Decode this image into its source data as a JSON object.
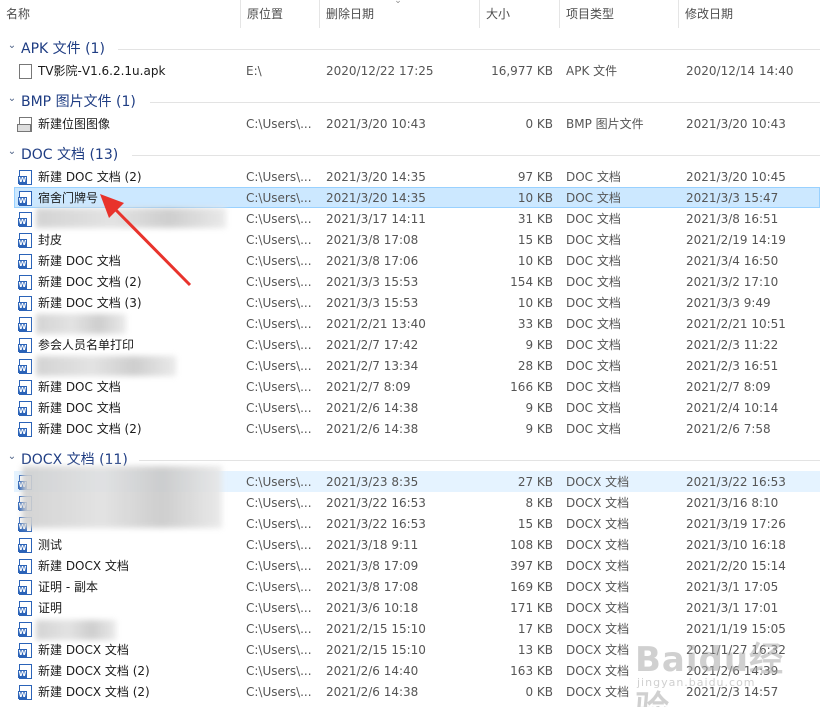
{
  "columns": {
    "name": "名称",
    "location": "原位置",
    "deleted": "删除日期",
    "size": "大小",
    "type": "项目类型",
    "modified": "修改日期"
  },
  "groups": [
    {
      "title": "APK 文件 (1)",
      "rows": [
        {
          "name": "TV影院-V1.6.2.1u.apk",
          "location": "E:\\",
          "deleted": "2020/12/22 17:25",
          "size": "16,977 KB",
          "type": "APK 文件",
          "modified": "2020/12/14 14:40",
          "icon": "apk-file-icon"
        }
      ]
    },
    {
      "title": "BMP 图片文件 (1)",
      "rows": [
        {
          "name": "新建位图图像",
          "location": "C:\\Users\\...",
          "deleted": "2021/3/20 10:43",
          "size": "0 KB",
          "type": "BMP 图片文件",
          "modified": "2021/3/20 10:43",
          "icon": "bmp-file-icon"
        }
      ]
    },
    {
      "title": "DOC 文档 (13)",
      "rows": [
        {
          "name": "新建 DOC 文档 (2)",
          "location": "C:\\Users\\...",
          "deleted": "2021/3/20 14:35",
          "size": "97 KB",
          "type": "DOC 文档",
          "modified": "2021/3/20 10:45"
        },
        {
          "name": "宿舍门牌号",
          "location": "C:\\Users\\...",
          "deleted": "2021/3/20 14:35",
          "size": "10 KB",
          "type": "DOC 文档",
          "modified": "2021/3/3 15:47"
        },
        {
          "name": "",
          "location": "C:\\Users\\...",
          "deleted": "2021/3/17 14:11",
          "size": "31 KB",
          "type": "DOC 文档",
          "modified": "2021/3/8 16:51"
        },
        {
          "name": "封皮",
          "location": "C:\\Users\\...",
          "deleted": "2021/3/8 17:08",
          "size": "15 KB",
          "type": "DOC 文档",
          "modified": "2021/2/19 14:19"
        },
        {
          "name": "新建 DOC 文档",
          "location": "C:\\Users\\...",
          "deleted": "2021/3/8 17:06",
          "size": "10 KB",
          "type": "DOC 文档",
          "modified": "2021/3/4 16:50"
        },
        {
          "name": "新建 DOC 文档 (2)",
          "location": "C:\\Users\\...",
          "deleted": "2021/3/3 15:53",
          "size": "154 KB",
          "type": "DOC 文档",
          "modified": "2021/3/2 17:10"
        },
        {
          "name": "新建 DOC 文档 (3)",
          "location": "C:\\Users\\...",
          "deleted": "2021/3/3 15:53",
          "size": "10 KB",
          "type": "DOC 文档",
          "modified": "2021/3/3 9:49"
        },
        {
          "name": "",
          "location": "C:\\Users\\...",
          "deleted": "2021/2/21 13:40",
          "size": "33 KB",
          "type": "DOC 文档",
          "modified": "2021/2/21 10:51"
        },
        {
          "name": "参会人员名单打印",
          "location": "C:\\Users\\...",
          "deleted": "2021/2/7 17:42",
          "size": "9 KB",
          "type": "DOC 文档",
          "modified": "2021/2/3 11:22"
        },
        {
          "name": "",
          "location": "C:\\Users\\...",
          "deleted": "2021/2/7 13:34",
          "size": "28 KB",
          "type": "DOC 文档",
          "modified": "2021/2/3 16:51"
        },
        {
          "name": "新建 DOC 文档",
          "location": "C:\\Users\\...",
          "deleted": "2021/2/7 8:09",
          "size": "166 KB",
          "type": "DOC 文档",
          "modified": "2021/2/7 8:09"
        },
        {
          "name": "新建 DOC 文档",
          "location": "C:\\Users\\...",
          "deleted": "2021/2/6 14:38",
          "size": "9 KB",
          "type": "DOC 文档",
          "modified": "2021/2/4 10:14"
        },
        {
          "name": "新建 DOC 文档 (2)",
          "location": "C:\\Users\\...",
          "deleted": "2021/2/6 14:38",
          "size": "9 KB",
          "type": "DOC 文档",
          "modified": "2021/2/6 7:58"
        }
      ]
    },
    {
      "title": "DOCX 文档 (11)",
      "rows": [
        {
          "name": "",
          "location": "C:\\Users\\...",
          "deleted": "2021/3/23 8:35",
          "size": "27 KB",
          "type": "DOCX 文档",
          "modified": "2021/3/22 16:53"
        },
        {
          "name": "",
          "location": "C:\\Users\\...",
          "deleted": "2021/3/22 16:53",
          "size": "8 KB",
          "type": "DOCX 文档",
          "modified": "2021/3/16 8:10"
        },
        {
          "name": "",
          "location": "C:\\Users\\...",
          "deleted": "2021/3/22 16:53",
          "size": "15 KB",
          "type": "DOCX 文档",
          "modified": "2021/3/19 17:26"
        },
        {
          "name": "测试",
          "location": "C:\\Users\\...",
          "deleted": "2021/3/18 9:11",
          "size": "108 KB",
          "type": "DOCX 文档",
          "modified": "2021/3/10 16:18"
        },
        {
          "name": "新建 DOCX 文档",
          "location": "C:\\Users\\...",
          "deleted": "2021/3/8 17:09",
          "size": "397 KB",
          "type": "DOCX 文档",
          "modified": "2021/2/20 15:14"
        },
        {
          "name": "证明 - 副本",
          "location": "C:\\Users\\...",
          "deleted": "2021/3/8 17:08",
          "size": "169 KB",
          "type": "DOCX 文档",
          "modified": "2021/3/1 17:05"
        },
        {
          "name": "证明",
          "location": "C:\\Users\\...",
          "deleted": "2021/3/6 10:18",
          "size": "171 KB",
          "type": "DOCX 文档",
          "modified": "2021/3/1 17:01"
        },
        {
          "name": "",
          "location": "C:\\Users\\...",
          "deleted": "2021/2/15 15:10",
          "size": "17 KB",
          "type": "DOCX 文档",
          "modified": "2021/1/19 15:05"
        },
        {
          "name": "新建 DOCX 文档",
          "location": "C:\\Users\\...",
          "deleted": "2021/2/15 15:10",
          "size": "13 KB",
          "type": "DOCX 文档",
          "modified": "2021/1/27 16:32"
        },
        {
          "name": "新建 DOCX 文档 (2)",
          "location": "C:\\Users\\...",
          "deleted": "2021/2/6 14:40",
          "size": "163 KB",
          "type": "DOCX 文档",
          "modified": "2021/2/6 14:39"
        },
        {
          "name": "新建 DOCX 文档 (2)",
          "location": "C:\\Users\\...",
          "deleted": "2021/2/6 14:38",
          "size": "0 KB",
          "type": "DOCX 文档",
          "modified": "2021/2/3 14:57"
        }
      ]
    }
  ],
  "selected_row": "宿舍门牌号",
  "watermark": {
    "logo": "Baidu经验",
    "url": "jingyan.baidu.com"
  },
  "colors": {
    "selection": "#cce8ff",
    "hover": "#e5f3ff",
    "group_title": "#1f3d83",
    "arrow": "#e8332c"
  }
}
